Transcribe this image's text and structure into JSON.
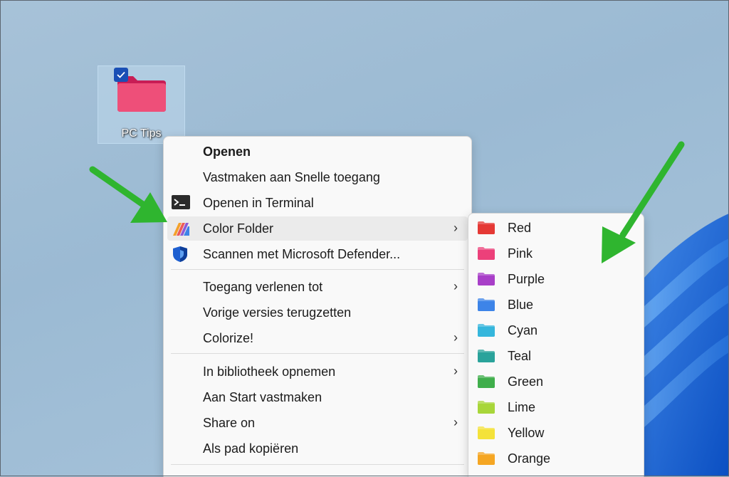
{
  "desktop": {
    "icon_label": "PC Tips",
    "folder_color": "#e8406a"
  },
  "context_menu": {
    "items": [
      {
        "label": "Openen",
        "bold": true
      },
      {
        "label": "Vastmaken aan Snelle toegang"
      },
      {
        "label": "Openen in Terminal",
        "icon": "terminal-icon"
      },
      {
        "label": "Color Folder",
        "icon": "color-folder-icon",
        "submenu": true,
        "highlighted": true
      },
      {
        "label": "Scannen met Microsoft Defender...",
        "icon": "defender-shield-icon"
      },
      {
        "label": "Toegang verlenen tot",
        "submenu": true
      },
      {
        "label": "Vorige versies terugzetten"
      },
      {
        "label": "Colorize!",
        "submenu": true
      },
      {
        "label": "In bibliotheek opnemen",
        "submenu": true
      },
      {
        "label": "Aan Start vastmaken"
      },
      {
        "label": "Share on",
        "submenu": true
      },
      {
        "label": "Als pad kopiëren"
      }
    ]
  },
  "color_submenu": {
    "items": [
      {
        "label": "Red",
        "color": "#e53935"
      },
      {
        "label": "Pink",
        "color": "#ec407a"
      },
      {
        "label": "Purple",
        "color": "#a83fc8"
      },
      {
        "label": "Blue",
        "color": "#3d84e8"
      },
      {
        "label": "Cyan",
        "color": "#35b6dc"
      },
      {
        "label": "Teal",
        "color": "#2aa39b"
      },
      {
        "label": "Green",
        "color": "#3fae4b"
      },
      {
        "label": "Lime",
        "color": "#a8d63a"
      },
      {
        "label": "Yellow",
        "color": "#f4e23a"
      },
      {
        "label": "Orange",
        "color": "#f5a623"
      }
    ]
  },
  "annotation_color": "#2fb52f"
}
